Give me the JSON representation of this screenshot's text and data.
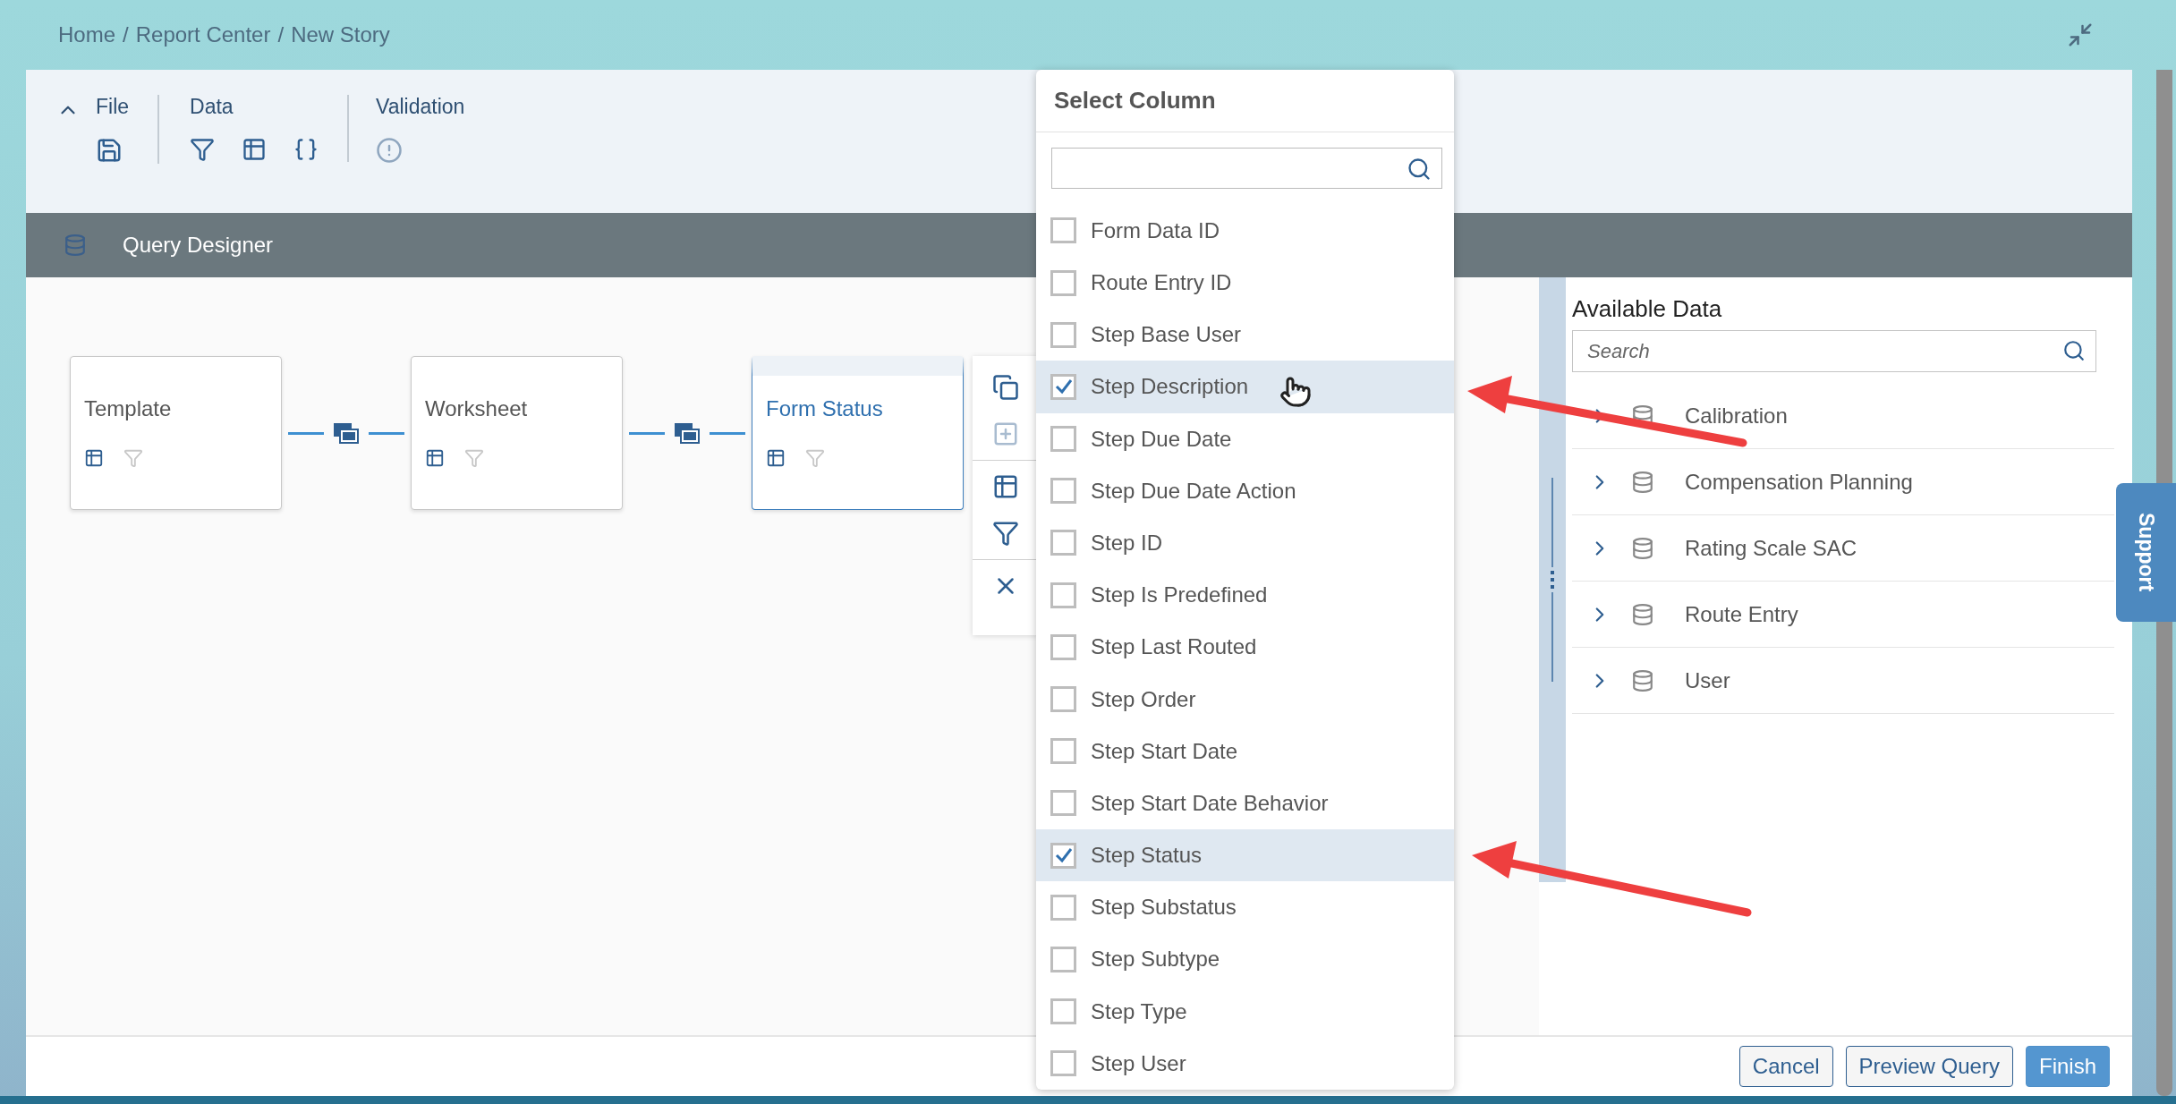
{
  "breadcrumb": {
    "separator": "/",
    "items": [
      "Home",
      "Report Center",
      "New Story"
    ]
  },
  "toolbar": {
    "groups": [
      {
        "label": "File",
        "kind": "file"
      },
      {
        "label": "Data",
        "kind": "data"
      },
      {
        "label": "Validation",
        "kind": "validation"
      }
    ]
  },
  "designer": {
    "title": "Query Designer"
  },
  "nodes": [
    {
      "label": "Template",
      "selected": false
    },
    {
      "label": "Worksheet",
      "selected": false
    },
    {
      "label": "Form Status",
      "selected": true
    }
  ],
  "available_data": {
    "title": "Available Data",
    "placeholder": "Search",
    "items": [
      {
        "label": "Calibration"
      },
      {
        "label": "Compensation Planning"
      },
      {
        "label": "Rating Scale SAC"
      },
      {
        "label": "Route Entry"
      },
      {
        "label": "User"
      }
    ]
  },
  "select_column": {
    "title": "Select Column",
    "columns": [
      {
        "label": "Form Data ID",
        "checked": false
      },
      {
        "label": "Route Entry ID",
        "checked": false
      },
      {
        "label": "Step Base User",
        "checked": false
      },
      {
        "label": "Step Description",
        "checked": true
      },
      {
        "label": "Step Due Date",
        "checked": false
      },
      {
        "label": "Step Due Date Action",
        "checked": false
      },
      {
        "label": "Step ID",
        "checked": false
      },
      {
        "label": "Step Is Predefined",
        "checked": false
      },
      {
        "label": "Step Last Routed",
        "checked": false
      },
      {
        "label": "Step Order",
        "checked": false
      },
      {
        "label": "Step Start Date",
        "checked": false
      },
      {
        "label": "Step Start Date Behavior",
        "checked": false
      },
      {
        "label": "Step Status",
        "checked": true
      },
      {
        "label": "Step Substatus",
        "checked": false
      },
      {
        "label": "Step Subtype",
        "checked": false
      },
      {
        "label": "Step Type",
        "checked": false
      },
      {
        "label": "Step User",
        "checked": false
      }
    ]
  },
  "buttons": [
    {
      "label": "Cancel",
      "kind": "secondary"
    },
    {
      "label": "Preview Query",
      "kind": "secondary"
    },
    {
      "label": "Finish",
      "kind": "primary"
    }
  ],
  "support_tab": "Support"
}
